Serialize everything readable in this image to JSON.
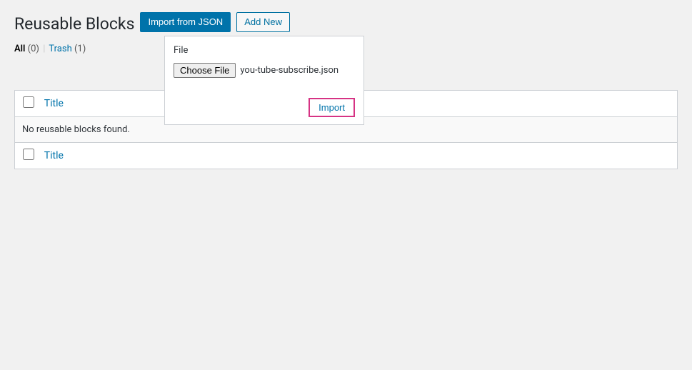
{
  "header": {
    "title": "Reusable Blocks",
    "import_json_label": "Import from JSON",
    "add_new_label": "Add New"
  },
  "filters": {
    "all_label": "All",
    "all_count": "(0)",
    "separator": "|",
    "trash_label": "Trash",
    "trash_count": "(1)"
  },
  "table": {
    "title_col": "Title",
    "empty_message": "No reusable blocks found."
  },
  "import_panel": {
    "file_label": "File",
    "choose_file_label": "Choose File",
    "filename": "you-tube-subscribe.json",
    "import_label": "Import"
  }
}
